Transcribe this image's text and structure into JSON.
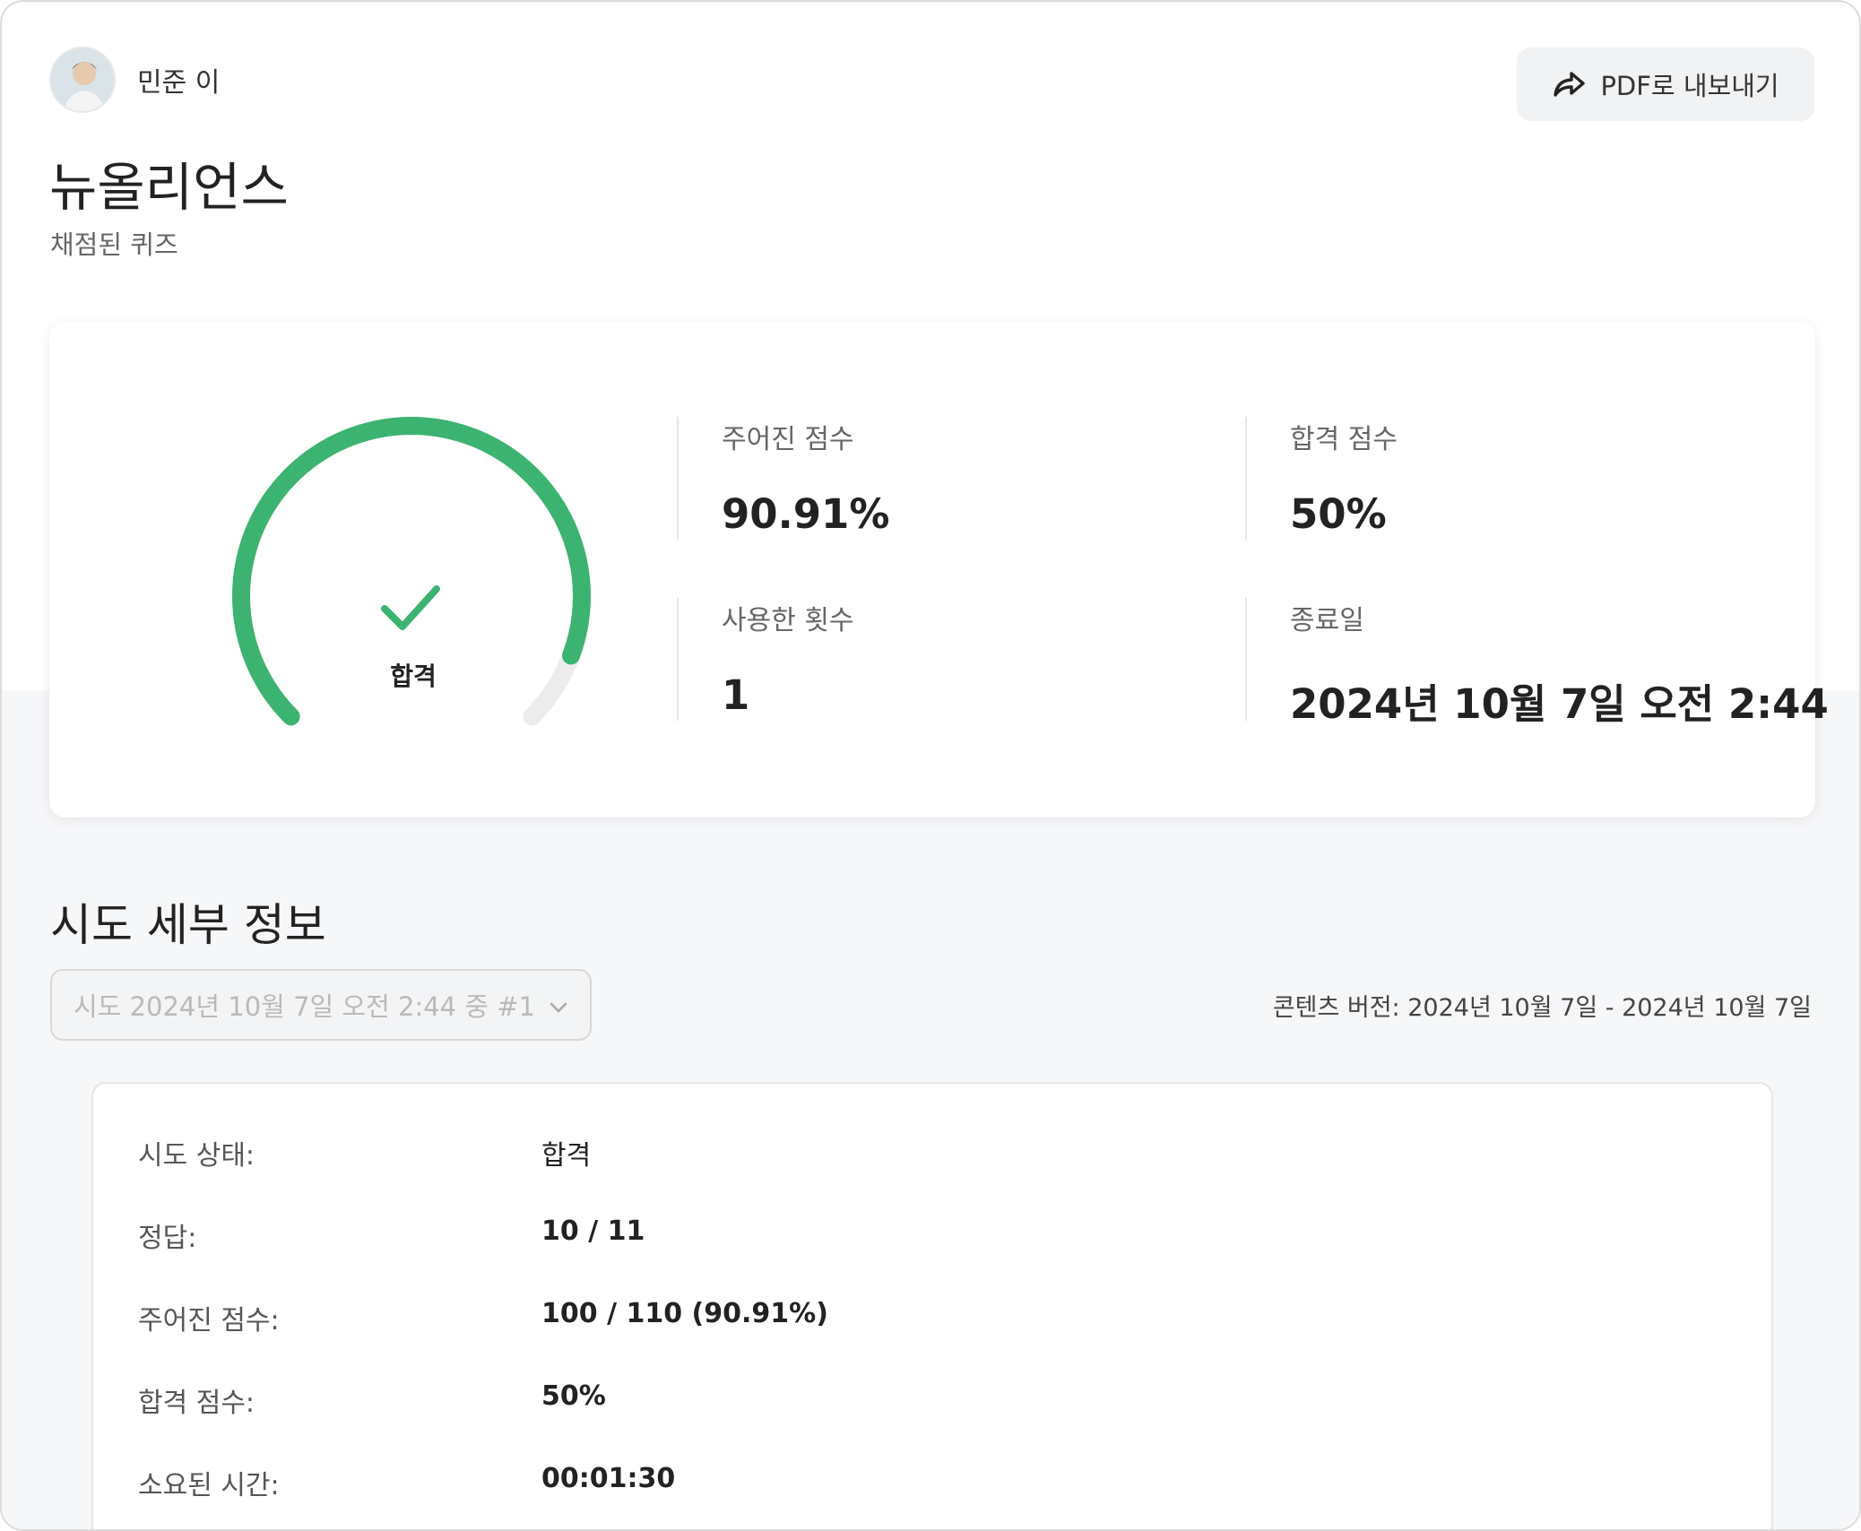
{
  "user": {
    "name": "민준 이",
    "avatar_icon": "user-avatar"
  },
  "header": {
    "export_label": "PDF로 내보내기",
    "export_icon": "share-arrow-icon",
    "title": "뉴올리언스",
    "subtitle": "채점된 퀴즈"
  },
  "summary": {
    "result_label": "합격",
    "gauge": {
      "score_fraction": 0.9091,
      "color": "#3cb371",
      "track_color": "#ececec"
    },
    "given_score_label": "주어진 점수",
    "given_score_value": "90.91%",
    "pass_score_label": "합격 점수",
    "pass_score_value": "50%",
    "attempts_label": "사용한 횟수",
    "attempts_value": "1",
    "end_date_label": "종료일",
    "end_date_value": "2024년 10월 7일 오전 2:44"
  },
  "attempt_details": {
    "title": "시도 세부 정보",
    "selected_attempt": "시도 2024년 10월 7일 오전 2:44 중 #1",
    "content_version": "콘텐츠 버전: 2024년 10월 7일 - 2024년 10월 7일",
    "rows": [
      {
        "key": "시도 상태:",
        "value": "합격"
      },
      {
        "key": "정답:",
        "value": "10 / 11"
      },
      {
        "key": "주어진 점수:",
        "value": "100 / 110 (90.91%)"
      },
      {
        "key": "합격 점수:",
        "value": "50%"
      },
      {
        "key": "소요된 시간:",
        "value": "00:01:30"
      }
    ]
  }
}
